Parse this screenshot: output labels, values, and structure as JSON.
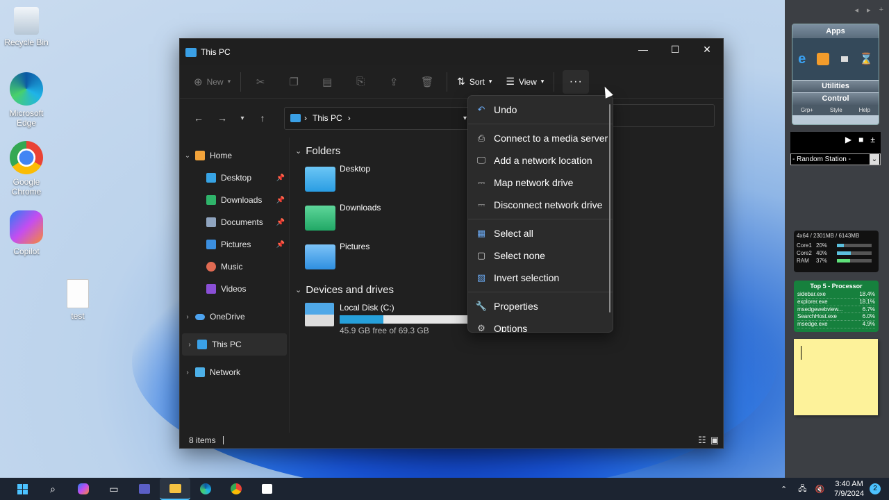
{
  "desktop": {
    "icons": [
      {
        "label": "Recycle Bin"
      },
      {
        "label": "Microsoft Edge"
      },
      {
        "label": "Google Chrome"
      },
      {
        "label": "Copilot"
      },
      {
        "label": "test"
      }
    ]
  },
  "explorer": {
    "title": "This PC",
    "toolbar": {
      "new_label": "New",
      "sort_label": "Sort",
      "view_label": "View",
      "more_label": "···"
    },
    "address": {
      "location": "This PC"
    },
    "sidebar": [
      {
        "label": "Home"
      },
      {
        "label": "Desktop"
      },
      {
        "label": "Downloads"
      },
      {
        "label": "Documents"
      },
      {
        "label": "Pictures"
      },
      {
        "label": "Music"
      },
      {
        "label": "Videos"
      },
      {
        "label": "OneDrive"
      },
      {
        "label": "This PC"
      },
      {
        "label": "Network"
      }
    ],
    "folders_header": "Folders",
    "folders": [
      {
        "label": "Desktop"
      },
      {
        "label": "Downloads"
      },
      {
        "label": "Pictures"
      }
    ],
    "drives_header": "Devices and drives",
    "drive": {
      "label": "Local Disk (C:)",
      "free_text": "45.9 GB free of 69.3 GB",
      "used_fraction": 0.34
    },
    "status_text": "8 items"
  },
  "context_menu": {
    "items": [
      {
        "label": "Undo",
        "icon": "undo-icon"
      },
      {
        "label": "Connect to a media server",
        "icon": "media-server-icon"
      },
      {
        "label": "Add a network location",
        "icon": "network-location-icon"
      },
      {
        "label": "Map network drive",
        "icon": "map-drive-icon"
      },
      {
        "label": "Disconnect network drive",
        "icon": "disconnect-drive-icon"
      },
      {
        "label": "Select all",
        "icon": "select-all-icon"
      },
      {
        "label": "Select none",
        "icon": "select-none-icon"
      },
      {
        "label": "Invert selection",
        "icon": "invert-selection-icon"
      },
      {
        "label": "Properties",
        "icon": "properties-icon"
      },
      {
        "label": "Options",
        "icon": "options-icon"
      }
    ]
  },
  "gadgets": {
    "apps": {
      "title": "Apps",
      "utilities": "Utilities",
      "control": "Control",
      "tabs": [
        "Grp+",
        "Style",
        "Help"
      ]
    },
    "media": {
      "station": "- Random Station -"
    },
    "cpu": {
      "header": "4x64 / 2301MB / 6143MB",
      "rows": [
        {
          "label": "Core1",
          "value": "20%",
          "fraction": 0.2
        },
        {
          "label": "Core2",
          "value": "40%",
          "fraction": 0.4
        },
        {
          "label": "RAM",
          "value": "37%",
          "fraction": 0.37
        }
      ]
    },
    "top5": {
      "title": "Top 5 - Processor",
      "rows": [
        {
          "name": "sidebar.exe",
          "value": "18.4%"
        },
        {
          "name": "explorer.exe",
          "value": "18.1%"
        },
        {
          "name": "msedgewebview...",
          "value": "6.7%"
        },
        {
          "name": "SearchHost.exe",
          "value": "6.0%"
        },
        {
          "name": "msedge.exe",
          "value": "4.9%"
        }
      ]
    }
  },
  "taskbar": {
    "time": "3:40 AM",
    "date": "7/9/2024",
    "notifications": "2"
  },
  "colors": {
    "accent": "#26a0da",
    "window_bg": "#202020",
    "menu_bg": "#2b2b2b",
    "taskbar_bg": "#1c2431"
  }
}
